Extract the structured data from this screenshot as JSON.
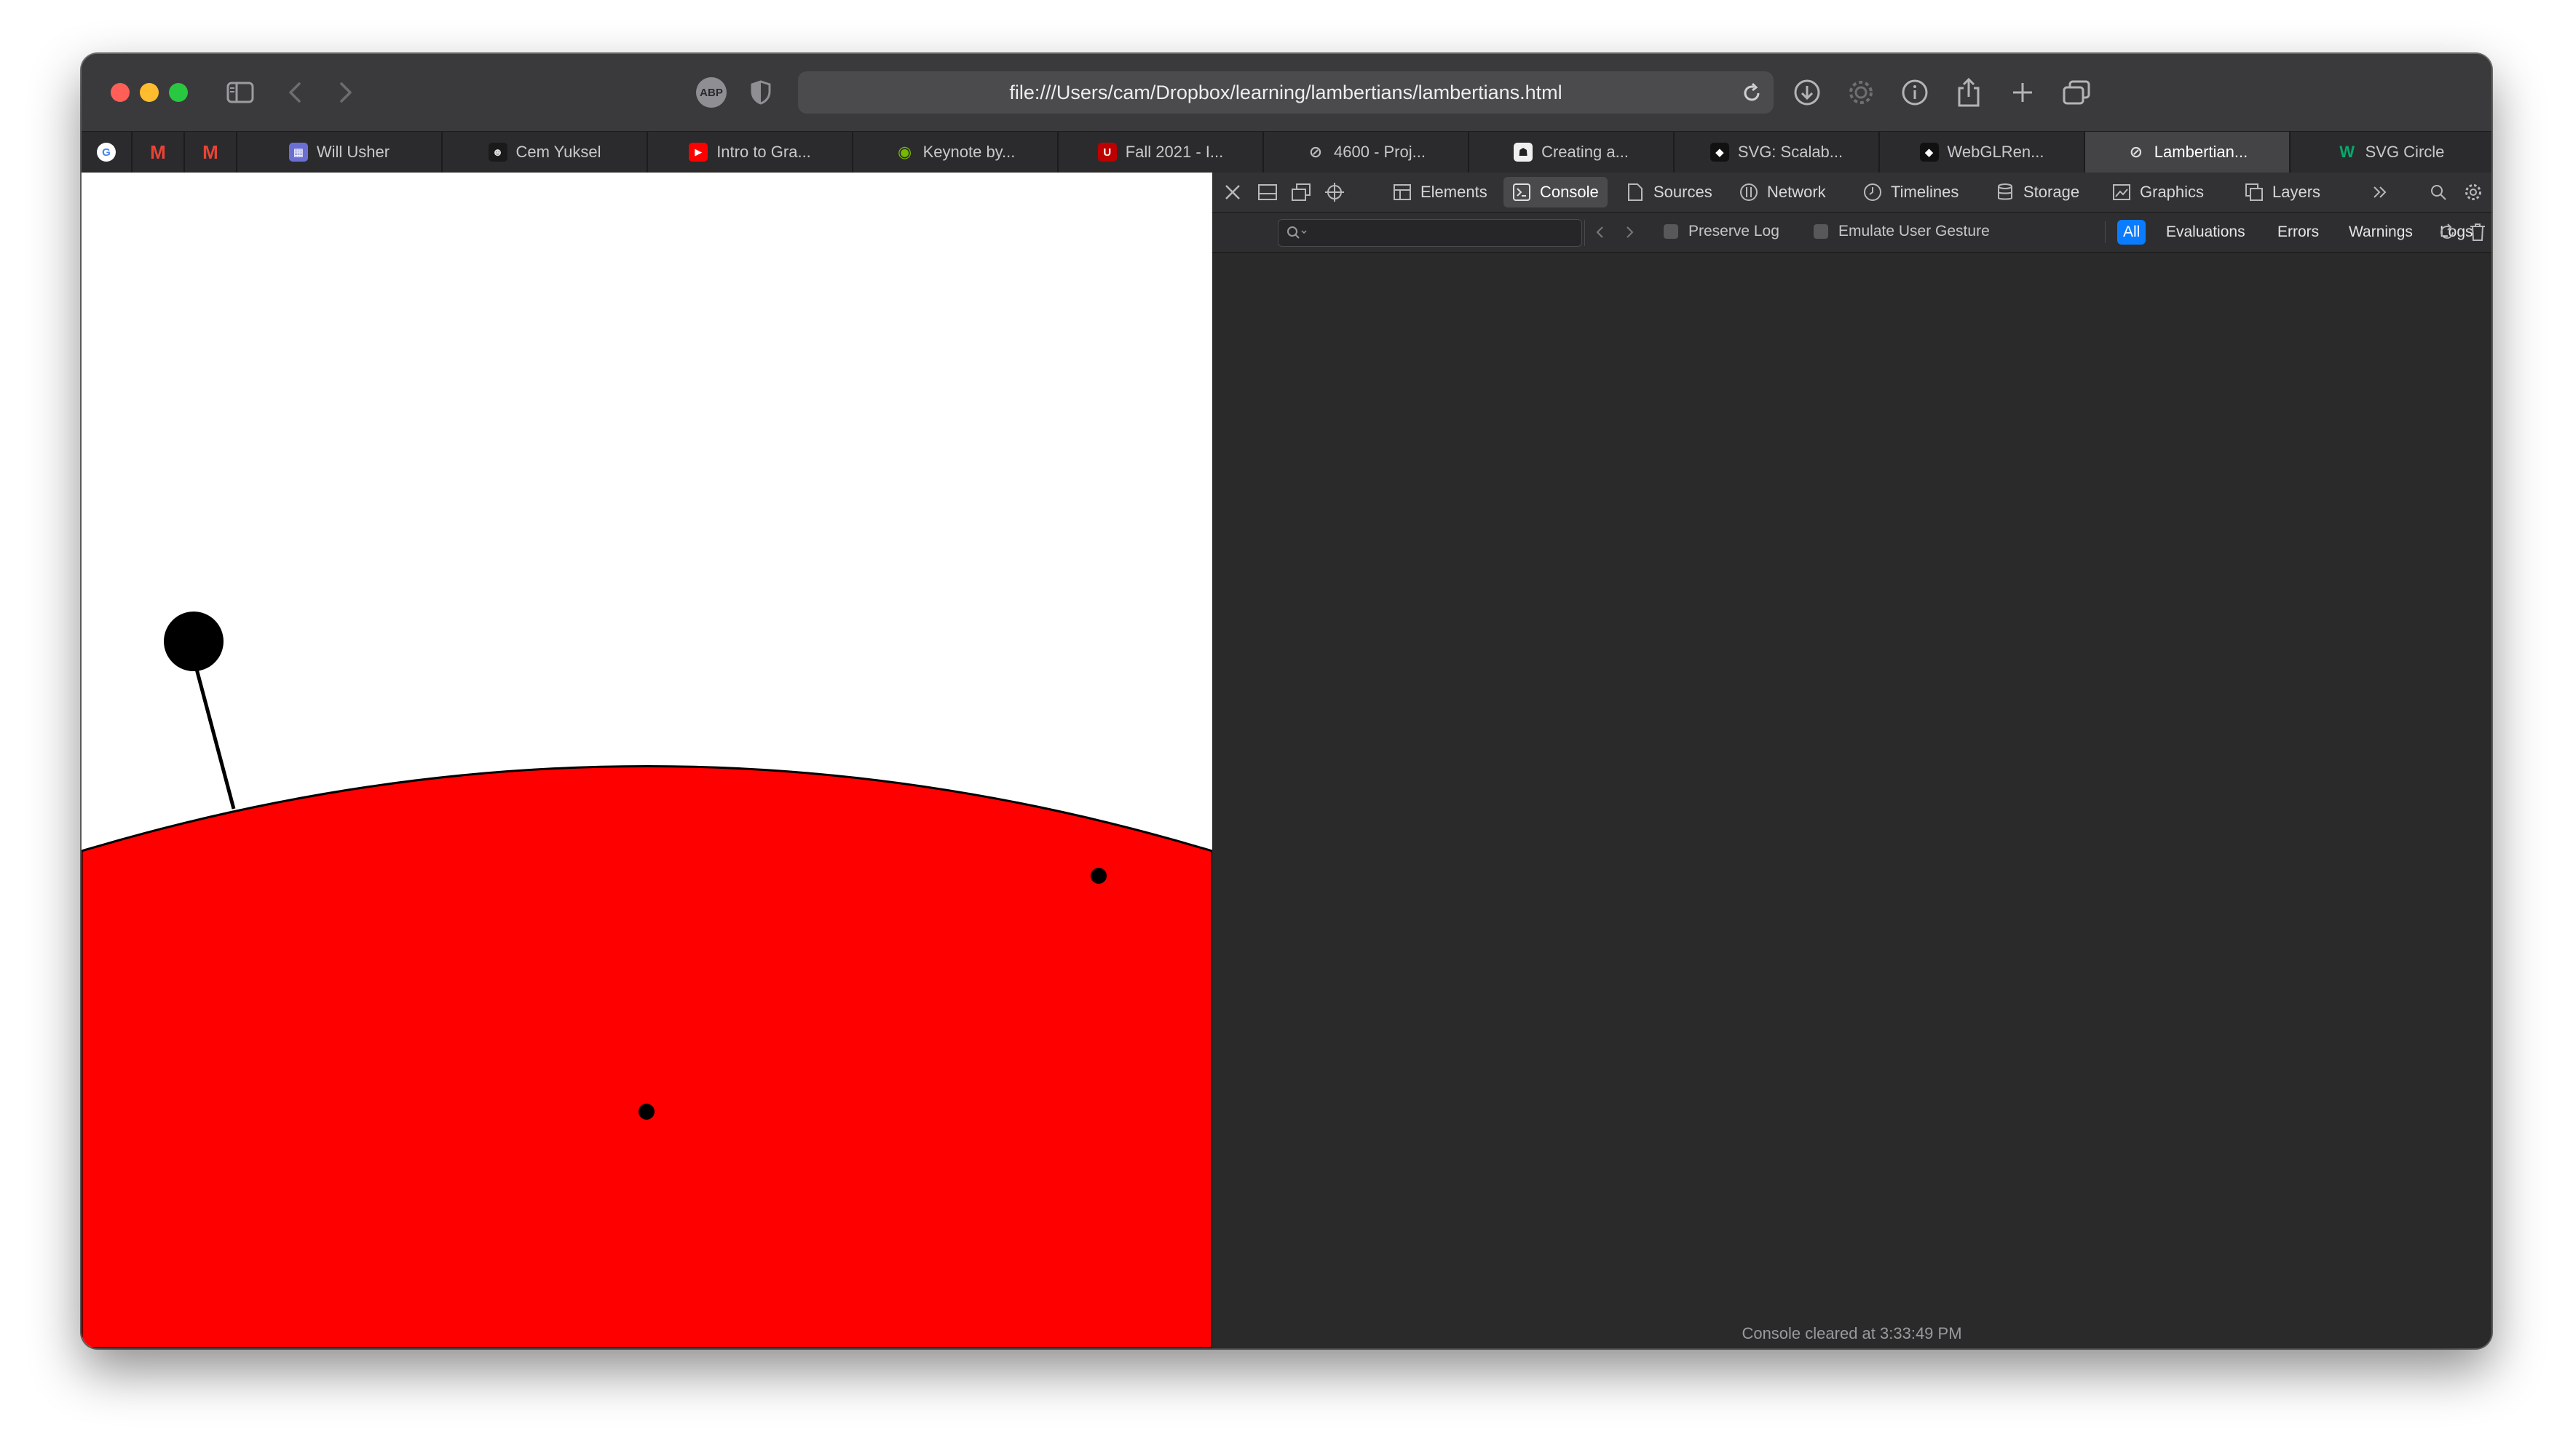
{
  "browser": {
    "url": "file:///Users/cam/Dropbox/learning/lambertians/lambertians.html",
    "abp_label": "ABP",
    "tabs": [
      {
        "label": "",
        "icon": "google-icon",
        "pinned": true
      },
      {
        "label": "",
        "icon": "gmail-icon",
        "pinned": true
      },
      {
        "label": "",
        "icon": "gmail-icon",
        "pinned": true
      },
      {
        "label": "Will Usher",
        "icon": "will-usher-favicon"
      },
      {
        "label": "Cem Yuksel",
        "icon": "cem-yuksel-favicon"
      },
      {
        "label": "Intro to Gra...",
        "icon": "youtube-icon"
      },
      {
        "label": "Keynote by...",
        "icon": "nvidia-icon"
      },
      {
        "label": "Fall 2021 - I...",
        "icon": "utah-icon"
      },
      {
        "label": "4600 - Proj...",
        "icon": "compass-icon"
      },
      {
        "label": "Creating a...",
        "icon": "github-icon"
      },
      {
        "label": "SVG: Scalab...",
        "icon": "mdn-icon"
      },
      {
        "label": "WebGLRen...",
        "icon": "mdn-icon"
      },
      {
        "label": "Lambertian...",
        "icon": "compass-icon",
        "active": true
      },
      {
        "label": "SVG Circle",
        "icon": "w3schools-icon"
      }
    ]
  },
  "canvas": {
    "background": "#ffffff",
    "ground_color": "#ff0000",
    "mark_color": "#000000"
  },
  "devtools": {
    "tabs": [
      {
        "label": "Elements",
        "icon": "elements-icon"
      },
      {
        "label": "Console",
        "icon": "console-icon",
        "active": true
      },
      {
        "label": "Sources",
        "icon": "sources-icon"
      },
      {
        "label": "Network",
        "icon": "network-icon"
      },
      {
        "label": "Timelines",
        "icon": "timelines-icon"
      },
      {
        "label": "Storage",
        "icon": "storage-icon"
      },
      {
        "label": "Graphics",
        "icon": "graphics-icon"
      },
      {
        "label": "Layers",
        "icon": "layers-icon"
      }
    ],
    "filter": {
      "search_placeholder": "",
      "preserve_log": "Preserve Log",
      "emulate_gesture": "Emulate User Gesture",
      "levels": [
        {
          "label": "All",
          "active": true
        },
        {
          "label": "Evaluations"
        },
        {
          "label": "Errors"
        },
        {
          "label": "Warnings"
        },
        {
          "label": "Logs"
        }
      ]
    },
    "console_status": "Console cleared at 3:33:49 PM",
    "prompt_symbol": "›",
    "accent": "#0a7cff"
  }
}
